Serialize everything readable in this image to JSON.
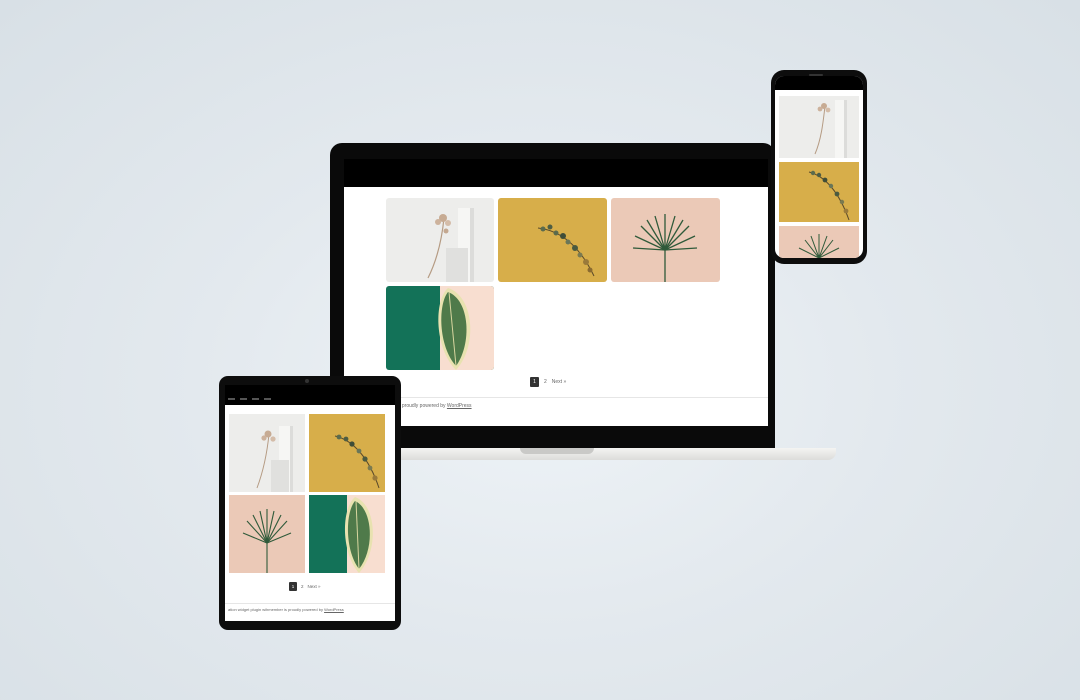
{
  "colors": {
    "gold": "#d7ae4a",
    "blush": "#ebc9b7",
    "green": "#137258",
    "offwhite": "#eeeeec",
    "bezel": "#0a0a0a"
  },
  "gallery": {
    "images": [
      {
        "label": "dried-flower-on-white",
        "bg": "#ededeb"
      },
      {
        "label": "eucalyptus-on-gold",
        "bg": "#d7ae4a"
      },
      {
        "label": "palm-leaf-on-blush",
        "bg": "#ebc9b7"
      },
      {
        "label": "ficus-leaf-on-green",
        "bg": "#137258"
      }
    ]
  },
  "pagination": {
    "current": "1",
    "page2": "2",
    "next": "Next »"
  },
  "footer": {
    "laptop_text": "s proudly powered by ",
    "tablet_text": "ation widget plugin wihmember is proudly powered by ",
    "link": "WordPress"
  }
}
